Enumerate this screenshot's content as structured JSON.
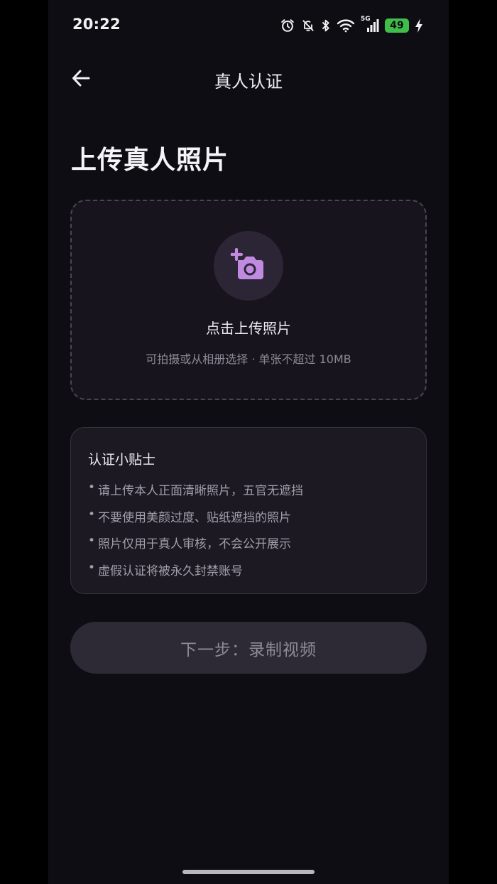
{
  "status_bar": {
    "time": "20:22",
    "network": "5G",
    "battery": "49",
    "icons": [
      "alarm-icon",
      "bell-off-icon",
      "bluetooth-icon",
      "wifi-icon",
      "signal-icon",
      "battery-icon",
      "charging-icon"
    ]
  },
  "nav": {
    "title": "真人认证",
    "back_icon": "arrow-left-icon"
  },
  "page": {
    "heading": "上传真人照片"
  },
  "upload": {
    "icon": "add-photo-icon",
    "title": "点击上传照片",
    "subtitle": "可拍摄或从相册选择 · 单张不超过 10MB"
  },
  "tips": {
    "title": "认证小贴士",
    "bullet": "•",
    "items": [
      "请上传本人正面清晰照片，五官无遮挡",
      "不要使用美颜过度、贴纸遮挡的照片",
      "照片仅用于真人审核，不会公开展示",
      "虚假认证将被永久封禁账号"
    ]
  },
  "next_button": {
    "label": "下一步：录制视频"
  },
  "colors": {
    "background": "#0f0d14",
    "accent": "#c08ae0",
    "battery": "#3fbf4a",
    "button_bg": "#2e2a35"
  }
}
